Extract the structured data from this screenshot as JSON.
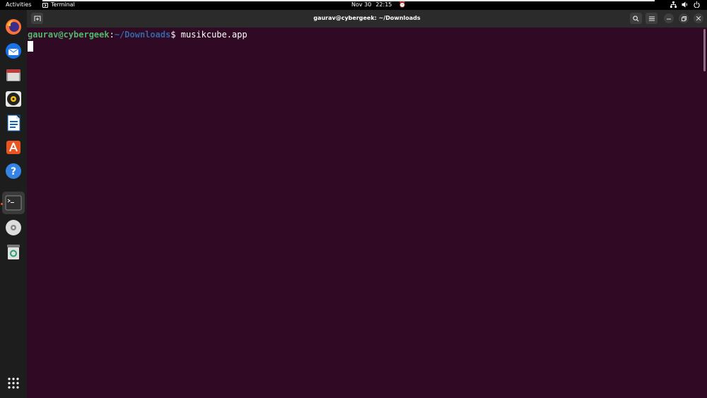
{
  "topbar": {
    "activities": "Activities",
    "app_name": "Terminal",
    "date": "Nov 30",
    "time": "22:15",
    "icons": [
      "network-icon",
      "volume-icon",
      "power-icon"
    ]
  },
  "dock": {
    "items": [
      {
        "name": "firefox",
        "icon": "firefox-icon"
      },
      {
        "name": "thunderbird",
        "icon": "thunderbird-icon"
      },
      {
        "name": "files",
        "icon": "files-icon"
      },
      {
        "name": "rhythmbox",
        "icon": "rhythmbox-icon"
      },
      {
        "name": "libreoffice-writer",
        "icon": "writer-icon"
      },
      {
        "name": "ubuntu-software",
        "icon": "software-icon"
      },
      {
        "name": "help",
        "icon": "help-icon"
      },
      {
        "name": "terminal",
        "icon": "terminal-icon",
        "active": true
      },
      {
        "name": "disc",
        "icon": "disc-icon"
      },
      {
        "name": "trash",
        "icon": "trash-icon"
      },
      {
        "name": "show-apps",
        "icon": "grid-icon"
      }
    ]
  },
  "window": {
    "title": "gaurav@cybergeek: ~/Downloads",
    "colors": {
      "background": "#300a24",
      "user": "#4fb86a",
      "path": "#3465a4"
    }
  },
  "terminal": {
    "user_host": "gaurav@cybergeek",
    "separator": ":",
    "path": "~/Downloads",
    "prompt_symbol": "$",
    "command": "musikcube.app"
  }
}
